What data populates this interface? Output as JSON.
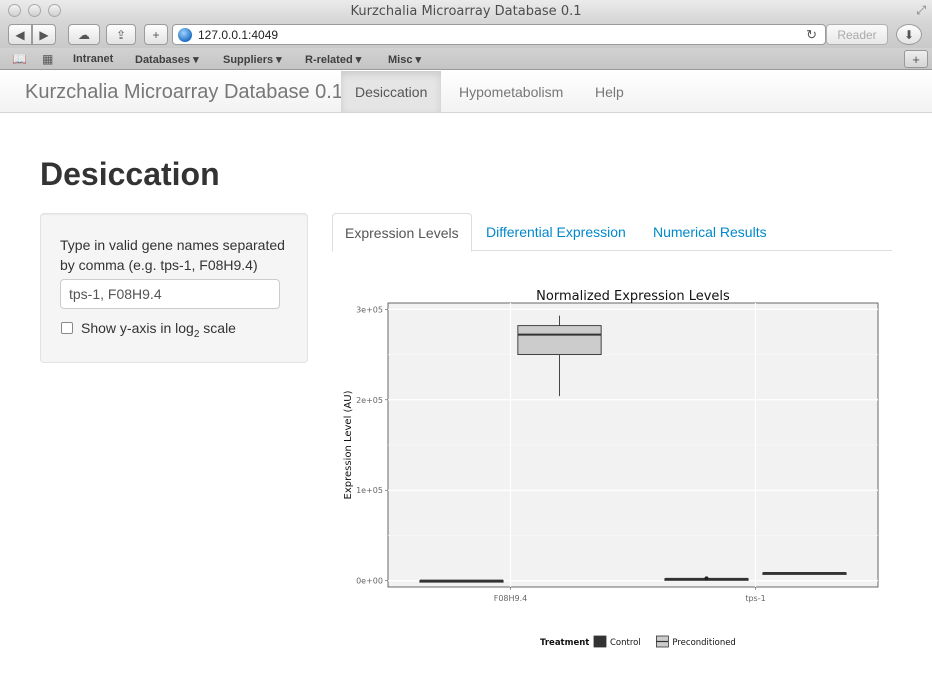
{
  "browser": {
    "window_title": "Kurzchalia Microarray Database 0.1",
    "url": "127.0.0.1:4049",
    "reader_label": "Reader",
    "bookmarks": [
      "Intranet",
      "Databases ▾",
      "Suppliers ▾",
      "R-related ▾",
      "Misc ▾"
    ],
    "icons": {
      "back": "back-arrow-icon",
      "forward": "forward-arrow-icon",
      "cloud": "cloud-icon",
      "share": "share-icon",
      "add": "plus-icon",
      "globe": "globe-icon",
      "reload": "reload-icon",
      "download": "download-icon",
      "reading_list": "book-icon",
      "top_sites": "grid-icon",
      "new_tab": "plus-icon"
    }
  },
  "navbar": {
    "brand": "Kurzchalia Microarray Database 0.1",
    "items": [
      {
        "label": "Desiccation",
        "active": true
      },
      {
        "label": "Hypometabolism",
        "active": false
      },
      {
        "label": "Help",
        "active": false
      }
    ]
  },
  "page": {
    "title": "Desiccation"
  },
  "sidebar": {
    "instructions": "Type in valid gene names separated by comma (e.g. tps-1, F08H9.4)",
    "gene_input_value": "tps-1, F08H9.4",
    "log_scale_label_prefix": "Show y-axis in log",
    "log_scale_label_sub": "2",
    "log_scale_label_suffix": " scale",
    "log_scale_checked": false
  },
  "tabs": [
    {
      "label": "Expression Levels",
      "active": true
    },
    {
      "label": "Differential Expression",
      "active": false
    },
    {
      "label": "Numerical Results",
      "active": false
    }
  ],
  "chart_data": {
    "type": "box",
    "title": "Normalized Expression Levels",
    "xlabel": "",
    "ylabel": "Expression Level (AU)",
    "ylim": [
      -7000,
      307000
    ],
    "yticks": [
      0,
      100000,
      200000,
      300000
    ],
    "ytick_labels": [
      "0e+00",
      "1e+05",
      "2e+05",
      "3e+05"
    ],
    "categories": [
      "F08H9.4",
      "tps-1"
    ],
    "legend": {
      "title": "Treatment",
      "position": "bottom",
      "entries": [
        {
          "name": "Control",
          "color": "#333333"
        },
        {
          "name": "Preconditioned",
          "color": "#cccccc"
        }
      ]
    },
    "series": [
      {
        "name": "Control",
        "boxes": [
          {
            "category": "F08H9.4",
            "min": 0,
            "q1": 0,
            "median": 0,
            "q3": 0,
            "max": 0
          },
          {
            "category": "tps-1",
            "min": 2000,
            "q1": 2000,
            "median": 2000,
            "q3": 2000,
            "max": 2000
          }
        ]
      },
      {
        "name": "Preconditioned",
        "boxes": [
          {
            "category": "F08H9.4",
            "min": 204000,
            "q1": 250000,
            "median": 272000,
            "q3": 282000,
            "max": 293000
          },
          {
            "category": "tps-1",
            "min": 8500,
            "q1": 8500,
            "median": 8500,
            "q3": 8500,
            "max": 8500
          }
        ]
      }
    ],
    "outliers": [
      {
        "series": "Control",
        "category": "tps-1",
        "value": 2500
      }
    ],
    "grid": true,
    "panel_background": "#f2f2f2"
  }
}
